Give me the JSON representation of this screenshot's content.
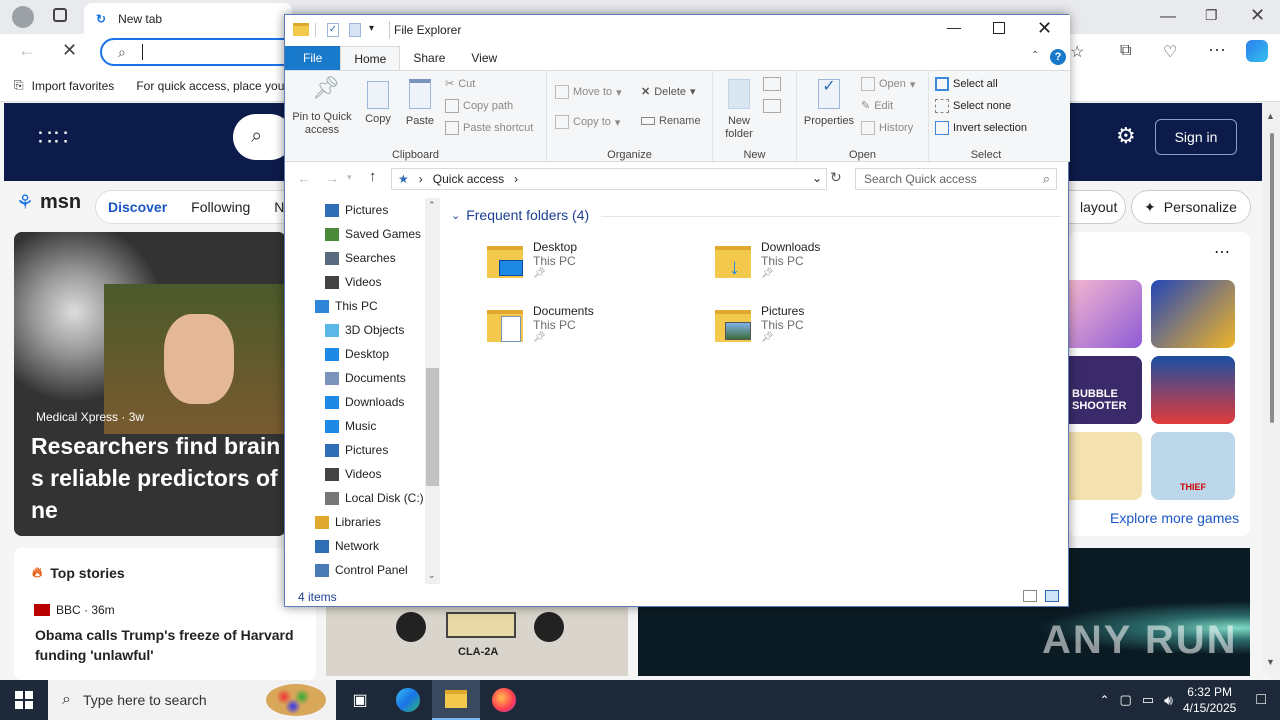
{
  "browser": {
    "tab_title": "New tab",
    "favorites": {
      "import": "Import favorites",
      "hint": "For quick access, place you"
    },
    "msn": {
      "logo": "msn",
      "nav": [
        "Discover",
        "Following",
        "N"
      ],
      "signin": "Sign in",
      "layout_btn": "layout",
      "personalize": "Personalize",
      "hero_source": "Medical Xpress · 3w",
      "hero_headline": "Researchers find brain s reliable predictors of ne",
      "top_stories": "Top stories",
      "story_source": "BBC · 36m",
      "story_headline": "Obama calls Trump's freeze of Harvard funding 'unlawful'",
      "explore_games": "Explore more games",
      "game_tile_label": "BUBBLE SHOOTER",
      "game_tile_label2": "THIEF",
      "device_label": "CLA-2A",
      "watermark": "ANY RUN"
    }
  },
  "explorer": {
    "title": "File Explorer",
    "ribbon_tabs": [
      "File",
      "Home",
      "Share",
      "View"
    ],
    "clipboard": {
      "label": "Clipboard",
      "pin": "Pin to Quick access",
      "copy": "Copy",
      "paste": "Paste",
      "cut": "Cut",
      "copy_path": "Copy path",
      "paste_shortcut": "Paste shortcut"
    },
    "organize": {
      "label": "Organize",
      "move_to": "Move to",
      "copy_to": "Copy to",
      "delete": "Delete",
      "rename": "Rename"
    },
    "new": {
      "label": "New",
      "new_folder": "New folder"
    },
    "open": {
      "label": "Open",
      "properties": "Properties",
      "open": "Open",
      "edit": "Edit",
      "history": "History"
    },
    "select": {
      "label": "Select",
      "select_all": "Select all",
      "select_none": "Select none",
      "invert": "Invert selection"
    },
    "address": {
      "location": "Quick access"
    },
    "search_placeholder": "Search Quick access",
    "nav_items": [
      {
        "label": "Pictures",
        "icon": "pictures-icon",
        "indent": 1
      },
      {
        "label": "Saved Games",
        "icon": "saved-games-icon",
        "indent": 1
      },
      {
        "label": "Searches",
        "icon": "searches-icon",
        "indent": 1
      },
      {
        "label": "Videos",
        "icon": "videos-icon",
        "indent": 1
      },
      {
        "label": "This PC",
        "icon": "this-pc-icon",
        "indent": 0
      },
      {
        "label": "3D Objects",
        "icon": "3d-objects-icon",
        "indent": 1
      },
      {
        "label": "Desktop",
        "icon": "desktop-icon",
        "indent": 1
      },
      {
        "label": "Documents",
        "icon": "documents-icon",
        "indent": 1
      },
      {
        "label": "Downloads",
        "icon": "downloads-icon",
        "indent": 1
      },
      {
        "label": "Music",
        "icon": "music-icon",
        "indent": 1
      },
      {
        "label": "Pictures",
        "icon": "pictures-icon",
        "indent": 1
      },
      {
        "label": "Videos",
        "icon": "videos-icon",
        "indent": 1
      },
      {
        "label": "Local Disk (C:)",
        "icon": "local-disk-icon",
        "indent": 1
      },
      {
        "label": "Libraries",
        "icon": "libraries-icon",
        "indent": 0
      },
      {
        "label": "Network",
        "icon": "network-icon",
        "indent": 0
      },
      {
        "label": "Control Panel",
        "icon": "control-panel-icon",
        "indent": 0
      }
    ],
    "section_header": "Frequent folders (4)",
    "folders": [
      {
        "name": "Desktop",
        "location": "This PC"
      },
      {
        "name": "Downloads",
        "location": "This PC"
      },
      {
        "name": "Documents",
        "location": "This PC"
      },
      {
        "name": "Pictures",
        "location": "This PC"
      }
    ],
    "status": "4 items"
  },
  "taskbar": {
    "search_placeholder": "Type here to search",
    "time": "6:32 PM",
    "date": "4/15/2025"
  },
  "colors": {
    "accent": "#1979ca",
    "taskbar": "#1d2939",
    "msn_blue": "#0d1b4a"
  }
}
